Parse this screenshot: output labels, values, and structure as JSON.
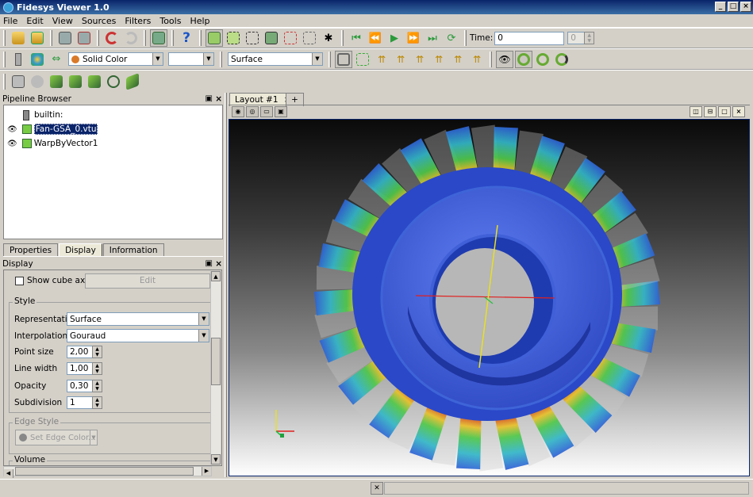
{
  "window": {
    "title": "Fidesys Viewer 1.0",
    "buttons": [
      "_",
      "□",
      "×"
    ]
  },
  "menu": [
    "File",
    "Edit",
    "View",
    "Sources",
    "Filters",
    "Tools",
    "Help"
  ],
  "toolbar": {
    "time_label": "Time:",
    "time_value": "0",
    "time_step": "0",
    "color_by": "Solid Color",
    "component": "",
    "representation": "Surface"
  },
  "pipeline": {
    "title": "Pipeline Browser",
    "items": [
      {
        "label": "builtin:"
      },
      {
        "label": "Fan-GSA_0.vtu"
      },
      {
        "label": "WarpByVector1"
      }
    ]
  },
  "tabs": [
    "Properties",
    "Display",
    "Information"
  ],
  "display": {
    "title": "Display",
    "show_cube_axes": "Show cube axes",
    "edit": "Edit",
    "style_group": "Style",
    "representation_label": "Representation",
    "representation_value": "Surface",
    "interpolation_label": "Interpolation",
    "interpolation_value": "Gouraud",
    "point_size_label": "Point size",
    "point_size_value": "2,00",
    "line_width_label": "Line width",
    "line_width_value": "1,00",
    "opacity_label": "Opacity",
    "opacity_value": "0,30",
    "subdivision_label": "Subdivision",
    "subdivision_value": "1",
    "edge_style_group": "Edge Style",
    "edge_color_button": "Set Edge Color...",
    "volume_group": "Volume"
  },
  "layout": {
    "tab": "Layout #1",
    "add": "+"
  },
  "colors": {
    "accent": "#0a246a",
    "panel": "#d4d0c8"
  }
}
